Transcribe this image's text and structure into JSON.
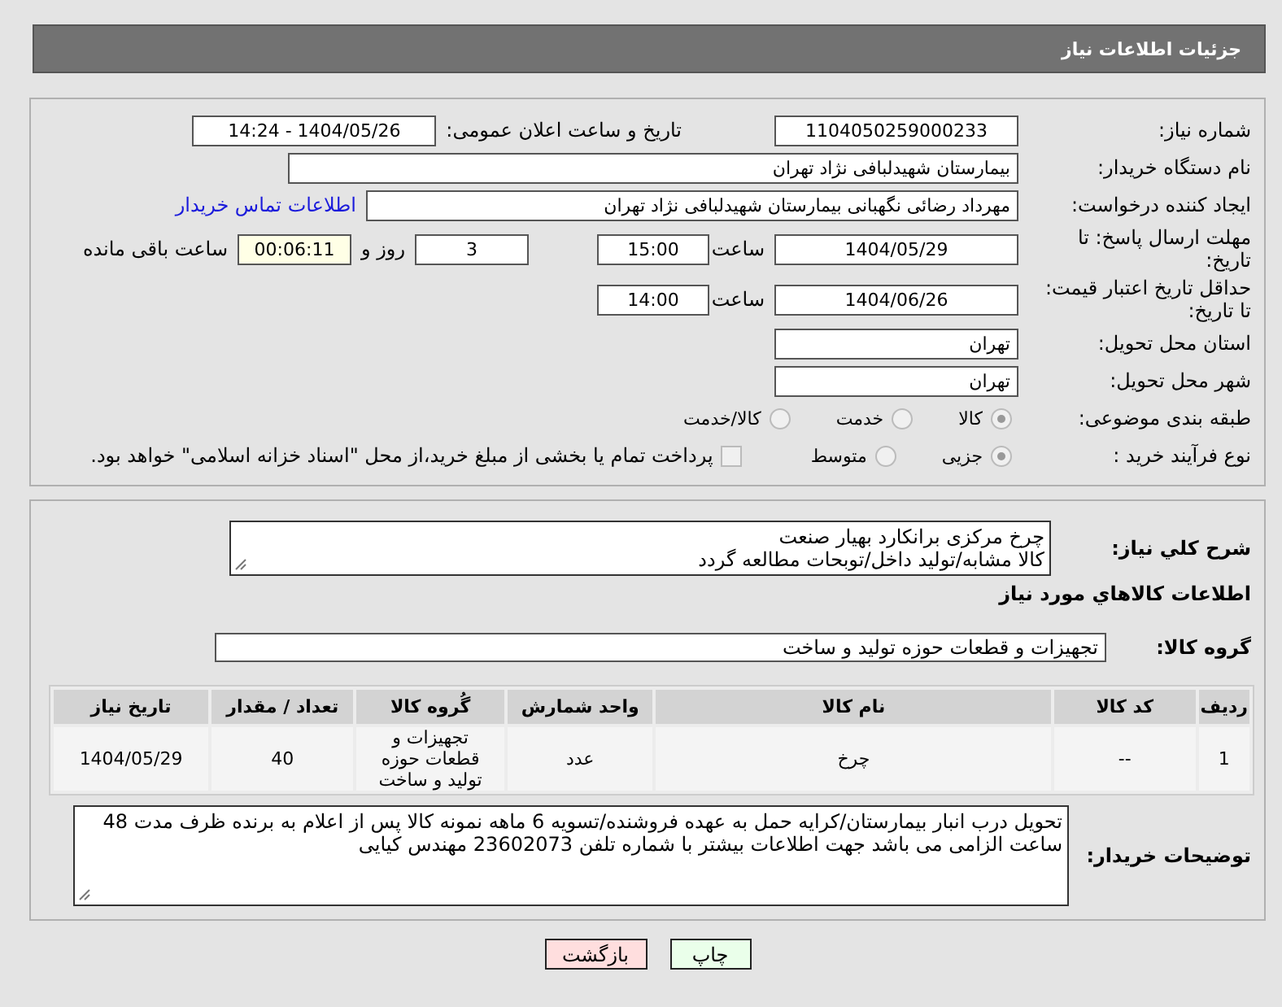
{
  "header": {
    "title": "جزئیات اطلاعات نیاز"
  },
  "form": {
    "need_number": {
      "label": "شماره نیاز:",
      "value": "1104050259000233"
    },
    "announce": {
      "label": "تاریخ و ساعت اعلان عمومی:",
      "value": "1404/05/26 - 14:24"
    },
    "buyer_org": {
      "label": "نام دستگاه خریدار:",
      "value": "بیمارستان شهیدلبافی نژاد تهران"
    },
    "requester": {
      "label": "ایجاد کننده درخواست:",
      "value": "مهرداد رضائی نگهبانی بیمارستان شهیدلبافی نژاد تهران",
      "link": "اطلاعات تماس خریدار"
    },
    "reply_deadline": {
      "label": "مهلت ارسال پاسخ: تا تاریخ:",
      "date": "1404/05/29",
      "time_label": "ساعت",
      "time": "15:00",
      "days": "3",
      "days_label": "روز و",
      "remaining": "00:06:11",
      "remaining_label": "ساعت باقی مانده"
    },
    "price_validity": {
      "label": "حداقل تاریخ اعتبار قیمت: تا تاریخ:",
      "date": "1404/06/26",
      "time_label": "ساعت",
      "time": "14:00"
    },
    "province": {
      "label": "استان محل تحویل:",
      "value": "تهران"
    },
    "city": {
      "label": "شهر محل تحویل:",
      "value": "تهران"
    },
    "category": {
      "label": "طبقه بندی موضوعی:",
      "options": [
        {
          "label": "کالا",
          "selected": true
        },
        {
          "label": "خدمت",
          "selected": false
        },
        {
          "label": "کالا/خدمت",
          "selected": false
        }
      ]
    },
    "process": {
      "label": "نوع فرآیند خرید :",
      "options": [
        {
          "label": "جزیی",
          "selected": true
        },
        {
          "label": "متوسط",
          "selected": false
        }
      ],
      "payment": {
        "label": "پرداخت تمام یا بخشی از مبلغ خرید،از محل \"اسناد خزانه اسلامی\" خواهد بود.",
        "checked": false
      }
    }
  },
  "details": {
    "summary": {
      "label": "شرح کلي نياز:",
      "lines": [
        "چرخ مرکزی برانکارد بهیار صنعت",
        "کالا مشابه/تولید داخل/توبحات مطالعه گردد"
      ]
    },
    "section_title": "اطلاعات کالاهاي مورد نياز",
    "group": {
      "label": "گروه کالا:",
      "value": "تجهیزات و قطعات حوزه تولید و ساخت"
    },
    "table": {
      "columns": [
        "ردیف",
        "کد کالا",
        "نام کالا",
        "واحد شمارش",
        "گُروه کالا",
        "تعداد / مقدار",
        "تاریخ نیاز"
      ],
      "rows": [
        [
          "1",
          "--",
          "چرخ",
          "عدد",
          "تجهیزات و قطعات حوزه تولید و ساخت",
          "40",
          "1404/05/29"
        ]
      ]
    },
    "notes": {
      "label": "توضیحات خریدار:",
      "lines": [
        "تحویل درب انبار بیمارستان/کرایه حمل به عهده فروشنده/تسویه 6 ماهه نمونه کالا پس از اعلام به برنده ظرف مدت 48 ساعت الزامی می باشد جهت اطلاعات بیشتر با شماره تلفن 23602073 مهندس کیایی"
      ]
    }
  },
  "buttons": [
    {
      "label": "چاپ",
      "color": "#eaffea"
    },
    {
      "label": "بازگشت",
      "color": "#ffdede"
    }
  ]
}
